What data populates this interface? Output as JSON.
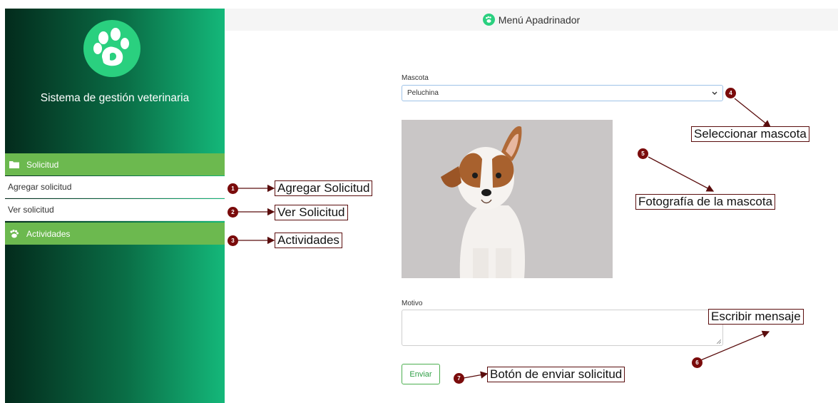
{
  "sidebar": {
    "app_name": "Sistema de gestión veterinaria",
    "sections": [
      {
        "label": "Solicitud",
        "icon": "folder-icon"
      },
      {
        "label": "Actividades",
        "icon": "paw-icon"
      }
    ],
    "items": [
      {
        "label": "Agregar solicitud"
      },
      {
        "label": "Ver solicitud"
      }
    ]
  },
  "header": {
    "title": "Menú Apadrinador"
  },
  "form": {
    "pet_label": "Mascota",
    "pet_value": "Peluchina",
    "reason_label": "Motivo",
    "reason_value": "",
    "submit_label": "Enviar"
  },
  "annotations": [
    {
      "number": "1",
      "text": "Agregar Solicitud"
    },
    {
      "number": "2",
      "text": "Ver Solicitud"
    },
    {
      "number": "3",
      "text": "Actividades"
    },
    {
      "number": "4",
      "text": "Seleccionar mascota"
    },
    {
      "number": "5",
      "text": "Fotografía de la mascota"
    },
    {
      "number": "6",
      "text": "Escribir mensaje"
    },
    {
      "number": "7",
      "text": "Botón de enviar solicitud"
    }
  ],
  "colors": {
    "accent_green": "#6cb94f",
    "annotation_red": "#7a0b0b",
    "brand_green": "#2ad07f"
  }
}
